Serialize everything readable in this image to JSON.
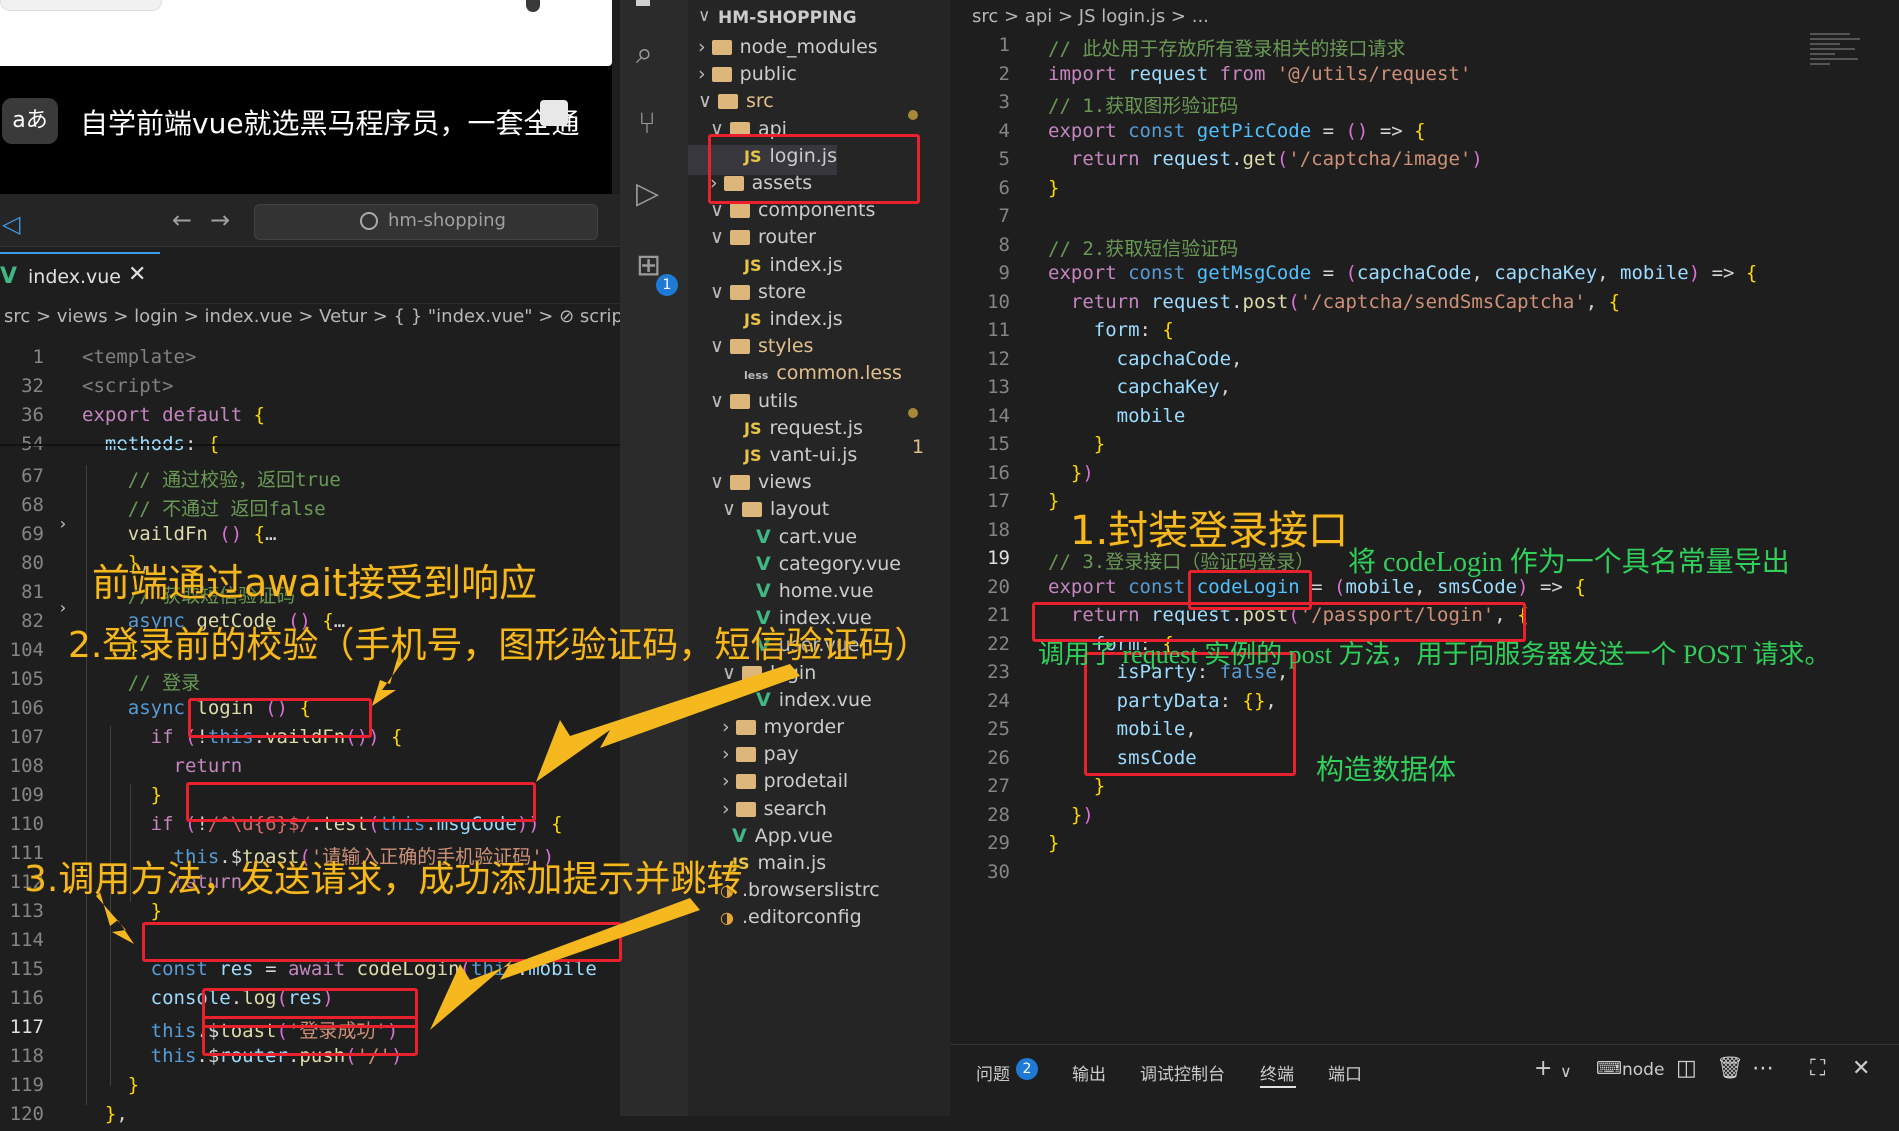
{
  "subtitle": {
    "aa_label": "aあ",
    "text": "自学前端vue就选黑马程序员，一套全通"
  },
  "left_window": {
    "search_text": "hm-shopping",
    "tab": {
      "name": "index.vue",
      "close": "✕"
    },
    "breadcrumb": "src > views > login > index.vue > Vetur > { } \"index.vue\" > ⊘ script",
    "lines": [
      {
        "n": "1",
        "code": "<template>"
      },
      {
        "n": "32",
        "code": "<script>"
      },
      {
        "n": "36",
        "code": "export default {"
      },
      {
        "n": "54",
        "code": "  methods: {"
      },
      {
        "n": "67",
        "code": "    // 通过校验，返回true"
      },
      {
        "n": "68",
        "code": "    // 不通过 返回false"
      },
      {
        "n": "69",
        "code": "    vaildFn () {…"
      },
      {
        "n": "80",
        "code": "    },"
      },
      {
        "n": "81",
        "code": "    // 获取短信验证码"
      },
      {
        "n": "82",
        "code": "    async getCode () {…"
      },
      {
        "n": "104",
        "code": "    },"
      },
      {
        "n": "105",
        "code": "    // 登录"
      },
      {
        "n": "106",
        "code": "    async login () {"
      },
      {
        "n": "107",
        "code": "      if (!this.vaildFn()) {"
      },
      {
        "n": "108",
        "code": "        return"
      },
      {
        "n": "109",
        "code": "      }"
      },
      {
        "n": "110",
        "code": "      if (!/^\\d{6}$/.test(this.msgCode)) {"
      },
      {
        "n": "111",
        "code": "        this.$toast('请输入正确的手机验证码')"
      },
      {
        "n": "112",
        "code": "        return"
      },
      {
        "n": "113",
        "code": "      }"
      },
      {
        "n": "114",
        "code": ""
      },
      {
        "n": "115",
        "code": "      const res = await codeLogin(this.mobile"
      },
      {
        "n": "116",
        "code": "      console.log(res)"
      },
      {
        "n": "117",
        "code": "      this.$toast('登录成功')"
      },
      {
        "n": "118",
        "code": "      this.$router.push('/')"
      },
      {
        "n": "119",
        "code": "    }"
      },
      {
        "n": "120",
        "code": "  },"
      }
    ]
  },
  "explorer": {
    "header": "HM-SHOPPING",
    "items": [
      {
        "label": "node_modules"
      },
      {
        "label": "public"
      },
      {
        "label": "src"
      },
      {
        "label": "api"
      },
      {
        "label": "login.js"
      },
      {
        "label": "assets"
      },
      {
        "label": "components"
      },
      {
        "label": "router"
      },
      {
        "label": "index.js"
      },
      {
        "label": "store"
      },
      {
        "label": "index.js"
      },
      {
        "label": "styles"
      },
      {
        "label": "common.less"
      },
      {
        "label": "utils"
      },
      {
        "label": "request.js"
      },
      {
        "label": "vant-ui.js"
      },
      {
        "label": "views"
      },
      {
        "label": "layout"
      },
      {
        "label": "cart.vue"
      },
      {
        "label": "category.vue"
      },
      {
        "label": "home.vue"
      },
      {
        "label": "index.vue"
      },
      {
        "label": "user.vue"
      },
      {
        "label": "login"
      },
      {
        "label": "index.vue"
      },
      {
        "label": "myorder"
      },
      {
        "label": "pay"
      },
      {
        "label": "prodetail"
      },
      {
        "label": "search"
      },
      {
        "label": "App.vue"
      },
      {
        "label": "main.js"
      },
      {
        "label": ".browserslistrc"
      },
      {
        "label": ".editorconfig"
      }
    ],
    "common_less_badge": "1",
    "source_control_badge": "1"
  },
  "right_window": {
    "breadcrumb": "src > api > JS login.js > ...",
    "lines": [
      {
        "n": "1",
        "code": "// 此处用于存放所有登录相关的接口请求"
      },
      {
        "n": "2",
        "code": "import request from '@/utils/request'"
      },
      {
        "n": "3",
        "code": "// 1.获取图形验证码"
      },
      {
        "n": "4",
        "code": "export const getPicCode = () => {"
      },
      {
        "n": "5",
        "code": "  return request.get('/captcha/image')"
      },
      {
        "n": "6",
        "code": "}"
      },
      {
        "n": "7",
        "code": ""
      },
      {
        "n": "8",
        "code": "// 2.获取短信验证码"
      },
      {
        "n": "9",
        "code": "export const getMsgCode = (capchaCode, capchaKey, mobile) => {"
      },
      {
        "n": "10",
        "code": "  return request.post('/captcha/sendSmsCaptcha', {"
      },
      {
        "n": "11",
        "code": "    form: {"
      },
      {
        "n": "12",
        "code": "      capchaCode,"
      },
      {
        "n": "13",
        "code": "      capchaKey,"
      },
      {
        "n": "14",
        "code": "      mobile"
      },
      {
        "n": "15",
        "code": "    }"
      },
      {
        "n": "16",
        "code": "  })"
      },
      {
        "n": "17",
        "code": "}"
      },
      {
        "n": "18",
        "code": ""
      },
      {
        "n": "19",
        "code": "// 3.登录接口（验证码登录）"
      },
      {
        "n": "20",
        "code": "export const codeLogin = (mobile, smsCode) => {"
      },
      {
        "n": "21",
        "code": "  return request.post('/passport/login', {"
      },
      {
        "n": "22",
        "code": "    form: {"
      },
      {
        "n": "23",
        "code": "      isParty: false,"
      },
      {
        "n": "24",
        "code": "      partyData: {},"
      },
      {
        "n": "25",
        "code": "      mobile,"
      },
      {
        "n": "26",
        "code": "      smsCode"
      },
      {
        "n": "27",
        "code": "    }"
      },
      {
        "n": "28",
        "code": "  })"
      },
      {
        "n": "29",
        "code": "}"
      },
      {
        "n": "30",
        "code": ""
      }
    ]
  },
  "panel": {
    "tabs": [
      "问题",
      "输出",
      "调试控制台",
      "终端",
      "端口"
    ],
    "problems_count": "2",
    "terminal_label": "node",
    "icons": [
      "plus-icon",
      "chevron-down-icon",
      "terminal-icon",
      "split-icon",
      "trash-icon",
      "more-icon",
      "maximize-icon",
      "close-icon"
    ]
  },
  "annotations": {
    "a1": "1.封装登录接口",
    "a1_note": "将 codeLogin 作为一个具名常量导出",
    "a_post": "调用了 request 实例的 post 方法，用于向服务器发送一个 POST 请求。",
    "a_body": "构造数据体",
    "a_await": "前端通过await接受到响应",
    "a2": "2.登录前的校验（手机号，图形验证码，短信验证码）",
    "a3": "3.调用方法，发送请求，成功添加提示并跳转"
  },
  "colors": {
    "annotation_yellow": "#f5b91f",
    "annotation_green": "#2fcf5a",
    "box_red": "#e8212c",
    "vue_green": "#41b883"
  }
}
